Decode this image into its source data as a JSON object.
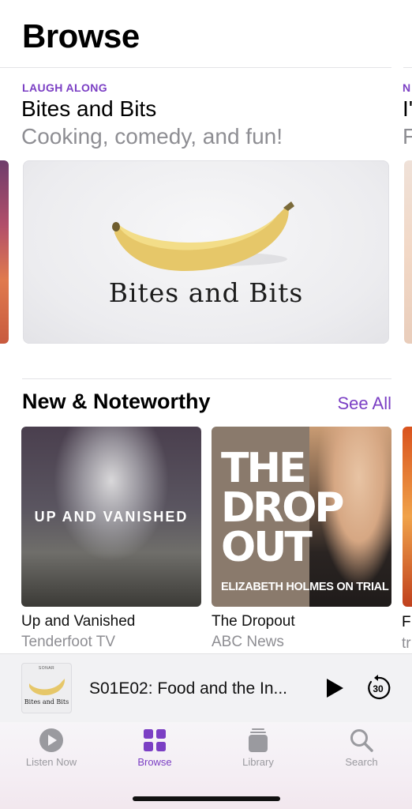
{
  "header": {
    "title": "Browse"
  },
  "featured": {
    "eyebrow": "LAUGH ALONG",
    "title": "Bites and Bits",
    "subtitle": "Cooking, comedy, and fun!",
    "art_label": "Bites and Bits",
    "next_eyebrow": "N",
    "next_title": "I'",
    "next_subtitle": "F"
  },
  "section": {
    "title": "New & Noteworthy",
    "see_all": "See All",
    "cards": [
      {
        "art_text": "UP AND VANISHED",
        "title": "Up and Vanished",
        "subtitle": "Tenderfoot TV"
      },
      {
        "art_text": "THE DROP OUT",
        "art_subtext": "ELIZABETH HOLMES ON TRIAL",
        "title": "The Dropout",
        "subtitle": "ABC News"
      },
      {
        "title": "F",
        "subtitle": "tr"
      }
    ]
  },
  "mini_player": {
    "art_brand": "SONAR",
    "art_label": "Bites and Bits",
    "episode_title": "S01E02: Food and the In...",
    "skip_seconds": "30",
    "icons": {
      "play": "play-icon",
      "skip": "skip-back-30-icon"
    }
  },
  "tabs": [
    {
      "label": "Listen Now",
      "icon": "listen-now-icon",
      "active": false
    },
    {
      "label": "Browse",
      "icon": "browse-grid-icon",
      "active": true
    },
    {
      "label": "Library",
      "icon": "library-icon",
      "active": false
    },
    {
      "label": "Search",
      "icon": "search-icon",
      "active": false
    }
  ],
  "colors": {
    "accent": "#7b3fc4",
    "secondary_text": "#8e8e93",
    "inactive_tab": "#9a9a9f"
  }
}
